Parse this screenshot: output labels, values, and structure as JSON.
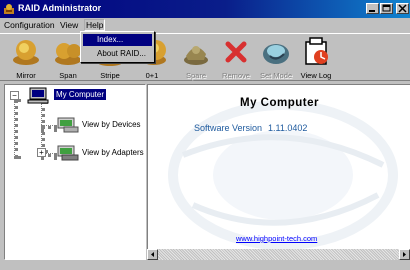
{
  "window": {
    "title": "RAID Administrator"
  },
  "menubar": {
    "configuration": "Configuration",
    "view": "View",
    "help": "Help"
  },
  "help_menu": {
    "items": [
      {
        "label": "Index..."
      },
      {
        "label": "About RAID..."
      }
    ]
  },
  "toolbar": {
    "items": [
      {
        "label": "Mirror",
        "icon": "mirror-icon",
        "enabled": true
      },
      {
        "label": "Span",
        "icon": "span-icon",
        "enabled": true
      },
      {
        "label": "Stripe",
        "icon": "stripe-icon",
        "enabled": true
      },
      {
        "label": "0+1",
        "icon": "raid01-icon",
        "enabled": true
      },
      {
        "label": "Spare",
        "icon": "spare-icon",
        "enabled": false
      },
      {
        "label": "Remove",
        "icon": "remove-icon",
        "enabled": false
      },
      {
        "label": "Set Mode",
        "icon": "set-mode-icon",
        "enabled": false
      },
      {
        "label": "View Log",
        "icon": "view-log-icon",
        "enabled": true
      }
    ]
  },
  "tree": {
    "root": {
      "label": "My Computer",
      "expander": "−"
    },
    "children": [
      {
        "label": "View by Devices"
      },
      {
        "label": "View by Adapters",
        "expander": "+"
      }
    ]
  },
  "main": {
    "title": "My Computer",
    "software_version_label": "Software Version",
    "software_version": "1.11.0402",
    "link": "www.highpoint-tech.com"
  },
  "colors": {
    "title_bar": "#000080",
    "selection": "#000080",
    "version_text": "#1e5a9e",
    "link": "#0000ff"
  }
}
